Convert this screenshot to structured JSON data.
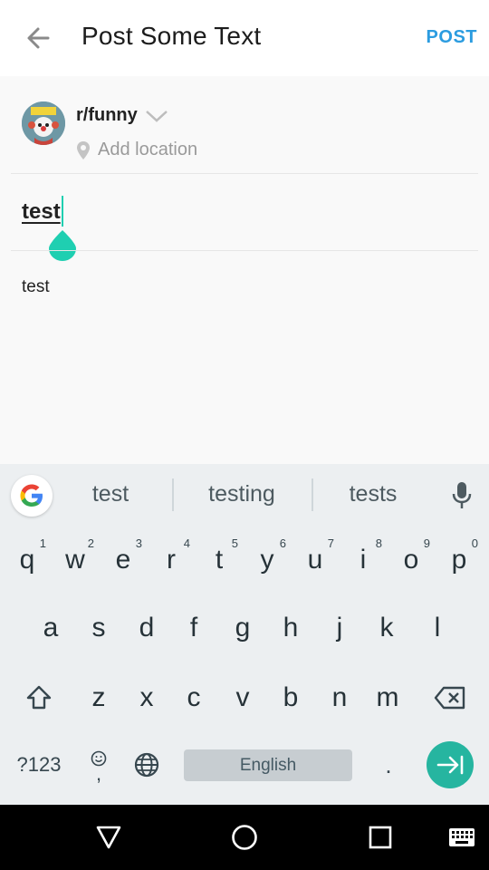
{
  "header": {
    "title": "Post Some Text",
    "post_label": "POST",
    "accent_color": "#2b9ce0"
  },
  "composer": {
    "community": "r/funny",
    "location_placeholder": "Add location",
    "title_value": "test",
    "body_value": "test",
    "cursor_color": "#1fcfb1"
  },
  "keyboard": {
    "suggestions": [
      "test",
      "testing",
      "tests"
    ],
    "row1": [
      {
        "key": "q",
        "hint": "1"
      },
      {
        "key": "w",
        "hint": "2"
      },
      {
        "key": "e",
        "hint": "3"
      },
      {
        "key": "r",
        "hint": "4"
      },
      {
        "key": "t",
        "hint": "5"
      },
      {
        "key": "y",
        "hint": "6"
      },
      {
        "key": "u",
        "hint": "7"
      },
      {
        "key": "i",
        "hint": "8"
      },
      {
        "key": "o",
        "hint": "9"
      },
      {
        "key": "p",
        "hint": "0"
      }
    ],
    "row2": [
      "a",
      "s",
      "d",
      "f",
      "g",
      "h",
      "j",
      "k",
      "l"
    ],
    "row3": [
      "z",
      "x",
      "c",
      "v",
      "b",
      "n",
      "m"
    ],
    "symbols_label": "?123",
    "comma_label": ",",
    "period_label": ".",
    "space_label": "English",
    "enter_color": "#26b5a0"
  },
  "icons": {
    "back": "arrow-left-icon",
    "dropdown": "chevron-down-icon",
    "location": "map-pin-icon",
    "google": "google-g-icon",
    "mic": "microphone-icon",
    "shift": "shift-icon",
    "backspace": "backspace-icon",
    "emoji": "emoji-icon",
    "globe": "globe-icon",
    "enter": "enter-arrow-icon",
    "nav_back": "triangle-back-icon",
    "nav_home": "circle-home-icon",
    "nav_recents": "square-recents-icon",
    "nav_keyboard": "keyboard-icon"
  }
}
